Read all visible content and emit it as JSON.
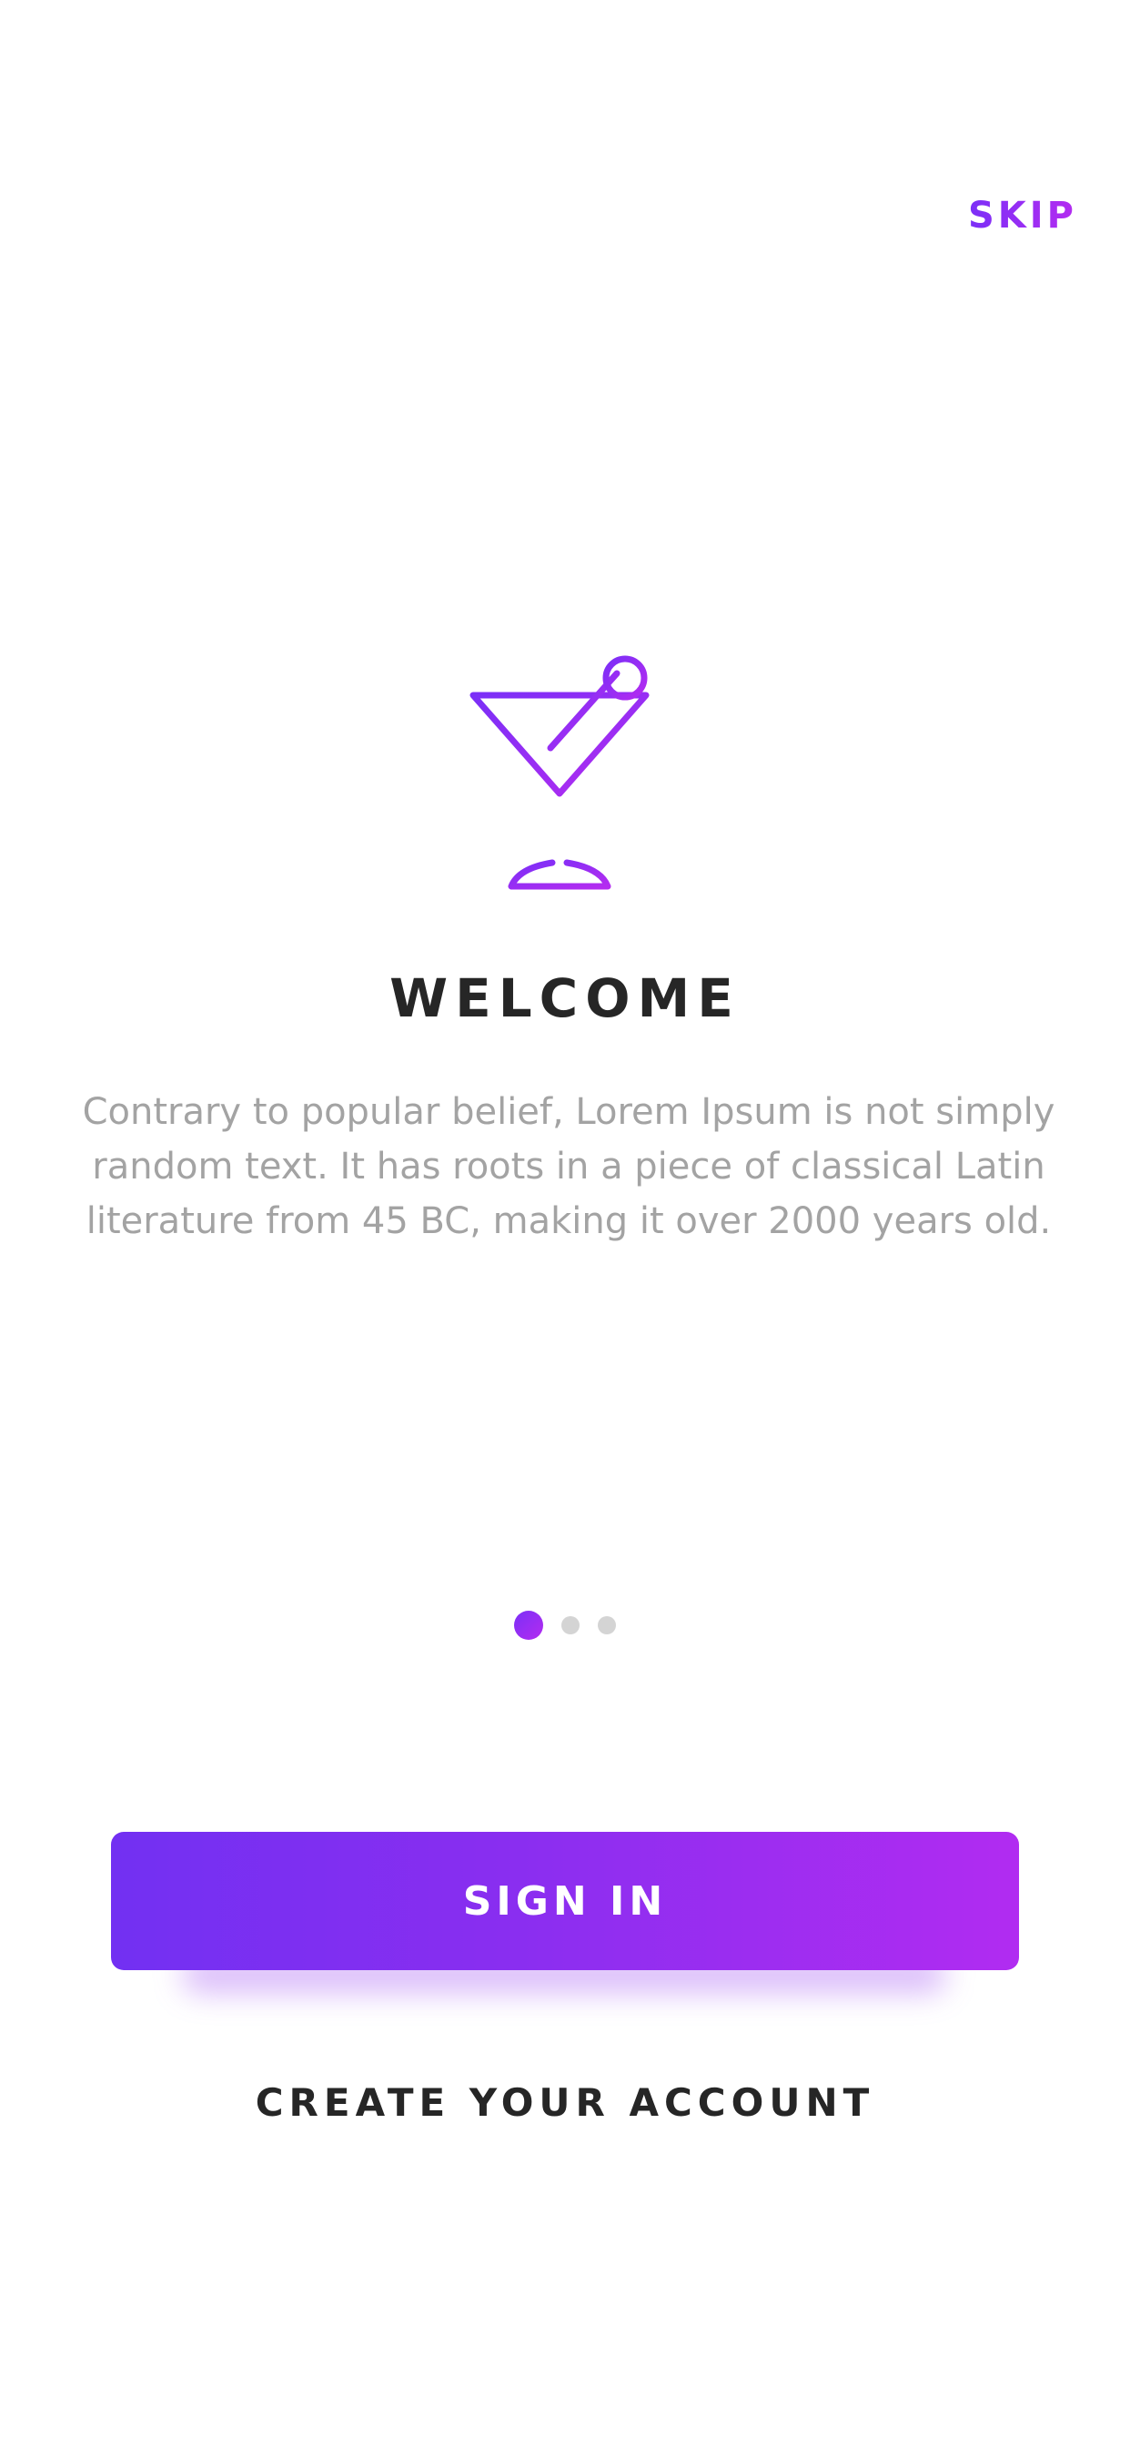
{
  "header": {
    "skip_label": "SKIP"
  },
  "onboarding": {
    "icon": "cocktail-glass-icon",
    "title": "WELCOME",
    "description": "Contrary to popular belief, Lorem Ipsum is not simply random text. It has roots in a piece of classical Latin literature from 45 BC, making it over 2000 years old.",
    "pager": {
      "total_pages": 3,
      "current_page": 1
    }
  },
  "actions": {
    "sign_in_label": "SIGN IN",
    "create_account_label": "CREATE YOUR ACCOUNT"
  },
  "colors": {
    "accent_start": "#7230f2",
    "accent_end": "#b12cf1",
    "title": "#262626",
    "body_text": "#a3a3a3",
    "inactive_dot": "#d4d4d4"
  }
}
